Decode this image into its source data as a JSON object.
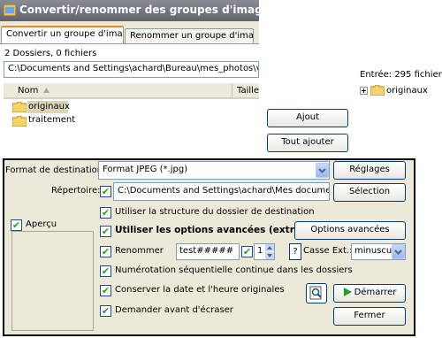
{
  "window": {
    "title": "Convertir/renommer des groupes d'images"
  },
  "tabs": [
    {
      "label": "Convertir un groupe d'images",
      "active": true
    },
    {
      "label": "Renommer un groupe d'images",
      "active": false
    }
  ],
  "browser": {
    "count": "2 Dossiers, 0 fichiers",
    "path": "C:\\Documents and Settings\\achard\\Bureau\\mes_photos\\vacance",
    "columns": [
      "Nom",
      "Taille"
    ],
    "items": [
      {
        "label": "originaux",
        "selected": true
      },
      {
        "label": "traitement",
        "selected": false
      }
    ]
  },
  "entries": {
    "header": "Entrée: 295 fichiers",
    "tree_item": "originaux"
  },
  "actions": {
    "add": "Ajout",
    "add_all": "Tout ajouter"
  },
  "dialog": {
    "format_label": "Format de destination:",
    "format_value": "Format JPEG (*.jpg)",
    "settings_button": "Réglages",
    "directory_label": "Répertoire:",
    "directory_value": "C:\\Documents and Settings\\achard\\Mes documents\\Me",
    "selection_button": "Sélection",
    "preview_label": "Aperçu",
    "use_structure": "Utiliser la structure du dossier de destination",
    "use_advanced": "Utiliser les options avancées (extraite...)",
    "advanced_button": "Options avancées",
    "rename_label": "Renommer",
    "rename_pattern": "test#####",
    "rename_start": "1",
    "help_button": "?",
    "case_label": "Casse Ext.:",
    "case_value": "minuscule",
    "sequential": "Numérotation séquentielle continue dans les dossiers",
    "keep_date": "Conserver la date et l'heure originales",
    "ask_overwrite": "Demander avant d'écraser",
    "start_button": "Démarrer",
    "close_button": "Fermer"
  },
  "colors": {
    "check": "#21a121",
    "title_bar": "#5f636b",
    "tab_accent": "#e68b2c",
    "folder": "#f5d46b"
  }
}
